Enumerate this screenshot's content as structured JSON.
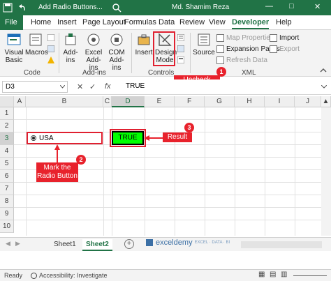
{
  "titlebar": {
    "file_name": "Add Radio Buttons...",
    "user": "Md. Shamim Reza",
    "autosave_icon": "save-icon",
    "min": "—",
    "max": "□",
    "close": "✕"
  },
  "tabs": [
    "File",
    "Home",
    "Insert",
    "Page Layout",
    "Formulas",
    "Data",
    "Review",
    "View",
    "Developer",
    "Help"
  ],
  "ribbon": {
    "code": {
      "label": "Code",
      "visual_basic": "Visual Basic",
      "macros": "Macros"
    },
    "addins": {
      "label": "Add-ins",
      "addins": "Add-ins",
      "excel_addins": "Excel Add-ins",
      "com_addins": "COM Add-ins"
    },
    "controls": {
      "label": "Controls",
      "insert": "Insert",
      "design_mode": "Design Mode"
    },
    "xml": {
      "label": "XML",
      "source": "Source",
      "map_properties": "Map Properties",
      "expansion_packs": "Expansion Packs",
      "refresh_data": "Refresh Data",
      "import": "Import",
      "export": "Export"
    }
  },
  "formula_bar": {
    "name_box": "D3",
    "fx": "fx",
    "content": "TRUE"
  },
  "columns": [
    "A",
    "B",
    "C",
    "D",
    "E",
    "F",
    "G",
    "H",
    "I",
    "J"
  ],
  "rows": [
    "1",
    "2",
    "3",
    "4",
    "5",
    "6",
    "7",
    "8",
    "9",
    "10"
  ],
  "cells": {
    "radio_label": "USA",
    "d3_value": "TRUE"
  },
  "callouts": {
    "c1": "Uncheck Design Mode",
    "c1_num": "1",
    "c2": "Mark the Radio Button",
    "c2_num": "2",
    "c3": "Result",
    "c3_num": "3"
  },
  "sheets": [
    "Sheet1",
    "Sheet2"
  ],
  "active_sheet": "Sheet2",
  "add_sheet": "+",
  "watermark": "exceldemy",
  "watermark_sub": "EXCEL · DATA · BI",
  "statusbar": {
    "ready": "Ready",
    "accessibility": "Accessibility: Investigate"
  }
}
